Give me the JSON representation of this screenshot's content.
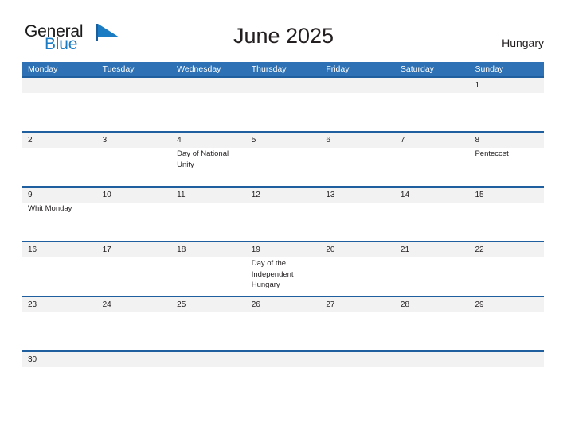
{
  "brand": {
    "name_part1": "General",
    "name_part2": "Blue",
    "flag_icon": "blue-triangle-flag-icon",
    "accent_color": "#1b7cc4"
  },
  "header": {
    "title": "June 2025",
    "country": "Hungary"
  },
  "colors": {
    "header_blue": "#2e72b5",
    "row_divider_blue": "#1f5fa0",
    "date_band_gray": "#f2f2f2",
    "text": "#231f20"
  },
  "calendar": {
    "weekday_headers": [
      "Monday",
      "Tuesday",
      "Wednesday",
      "Thursday",
      "Friday",
      "Saturday",
      "Sunday"
    ],
    "weeks": [
      {
        "dates": [
          "",
          "",
          "",
          "",
          "",
          "",
          "1"
        ],
        "events": [
          "",
          "",
          "",
          "",
          "",
          "",
          ""
        ]
      },
      {
        "dates": [
          "2",
          "3",
          "4",
          "5",
          "6",
          "7",
          "8"
        ],
        "events": [
          "",
          "",
          "Day of National Unity",
          "",
          "",
          "",
          "Pentecost"
        ]
      },
      {
        "dates": [
          "9",
          "10",
          "11",
          "12",
          "13",
          "14",
          "15"
        ],
        "events": [
          "Whit Monday",
          "",
          "",
          "",
          "",
          "",
          ""
        ]
      },
      {
        "dates": [
          "16",
          "17",
          "18",
          "19",
          "20",
          "21",
          "22"
        ],
        "events": [
          "",
          "",
          "",
          "Day of the Independent Hungary",
          "",
          "",
          ""
        ]
      },
      {
        "dates": [
          "23",
          "24",
          "25",
          "26",
          "27",
          "28",
          "29"
        ],
        "events": [
          "",
          "",
          "",
          "",
          "",
          "",
          ""
        ]
      },
      {
        "dates": [
          "30",
          "",
          "",
          "",
          "",
          "",
          ""
        ],
        "events": [
          "",
          "",
          "",
          "",
          "",
          "",
          ""
        ]
      }
    ]
  }
}
